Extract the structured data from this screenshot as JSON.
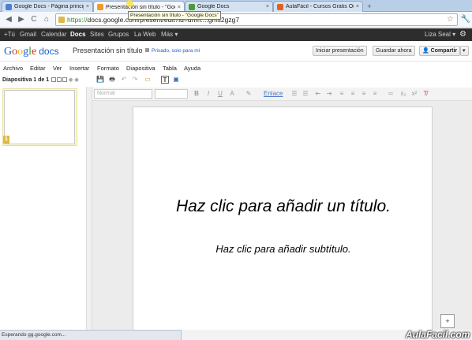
{
  "browser": {
    "tabs": [
      {
        "title": "Google Docs - Página principal",
        "color": "#4a7fd4"
      },
      {
        "title": "Presentación sin título - \"Goog",
        "color": "#f09a2a"
      },
      {
        "title": "Google Docs",
        "color": "#4a9a3a"
      },
      {
        "title": "AulaFácil - Cursos Gratis On-li",
        "color": "#e06020"
      }
    ],
    "close_glyph": "×",
    "newtab_glyph": "+",
    "url_scheme": "https://",
    "url_rest": "docs.google.com/present/edit?id=dhm....gms2gzg7",
    "tooltip": "Presentación sin título - \"Google Docs\"",
    "nav": {
      "back": "◀",
      "forward": "▶",
      "reload": "C",
      "home": "⌂"
    },
    "star_icon": "☆",
    "status": "Esperando gg.google.com..."
  },
  "gbar": {
    "items": [
      "+Tú",
      "Gmail",
      "Calendar",
      "Docs",
      "Sites",
      "Grupos",
      "La Web",
      "Más ▾"
    ],
    "active": "Docs",
    "user": "Liza Seal ▾"
  },
  "docs": {
    "logo_google": [
      "G",
      "o",
      "o",
      "g",
      "l",
      "e"
    ],
    "logo_docs": "docs",
    "title": "Presentación sin título",
    "privacy": "Privado, solo para mí",
    "buttons": {
      "start": "Iniciar presentación",
      "save": "Guardar ahora",
      "share": "Compartir",
      "share_dd": "▾"
    }
  },
  "menu": [
    "Archivo",
    "Editar",
    "Ver",
    "Insertar",
    "Formato",
    "Diapositiva",
    "Tabla",
    "Ayuda"
  ],
  "slides_header": "Diapositiva 1 de 1",
  "toolbar_icons": [
    "💾",
    "🖶",
    "↶",
    "↷",
    "▭",
    "T",
    "▣"
  ],
  "format": {
    "style": "Normal",
    "size": "",
    "bold": "B",
    "italic": "I",
    "underline": "U",
    "text_color": "A",
    "highlight": "✎",
    "link": "Enlace",
    "list_num": "☰",
    "list_bul": "☰",
    "indent_dec": "⇤",
    "indent_inc": "⇥",
    "align_l": "≡",
    "align_c": "≡",
    "align_r": "≡",
    "align_j": "≡",
    "line_sp": "═",
    "sub": "x₂",
    "sup": "x²",
    "clear": "T̸"
  },
  "slide": {
    "number": "1",
    "title_placeholder": "Haz clic para añadir un título.",
    "subtitle_placeholder": "Haz clic para añadir subtítulo."
  },
  "add_slide_icon": "+",
  "brand": "AulaFacil.com"
}
